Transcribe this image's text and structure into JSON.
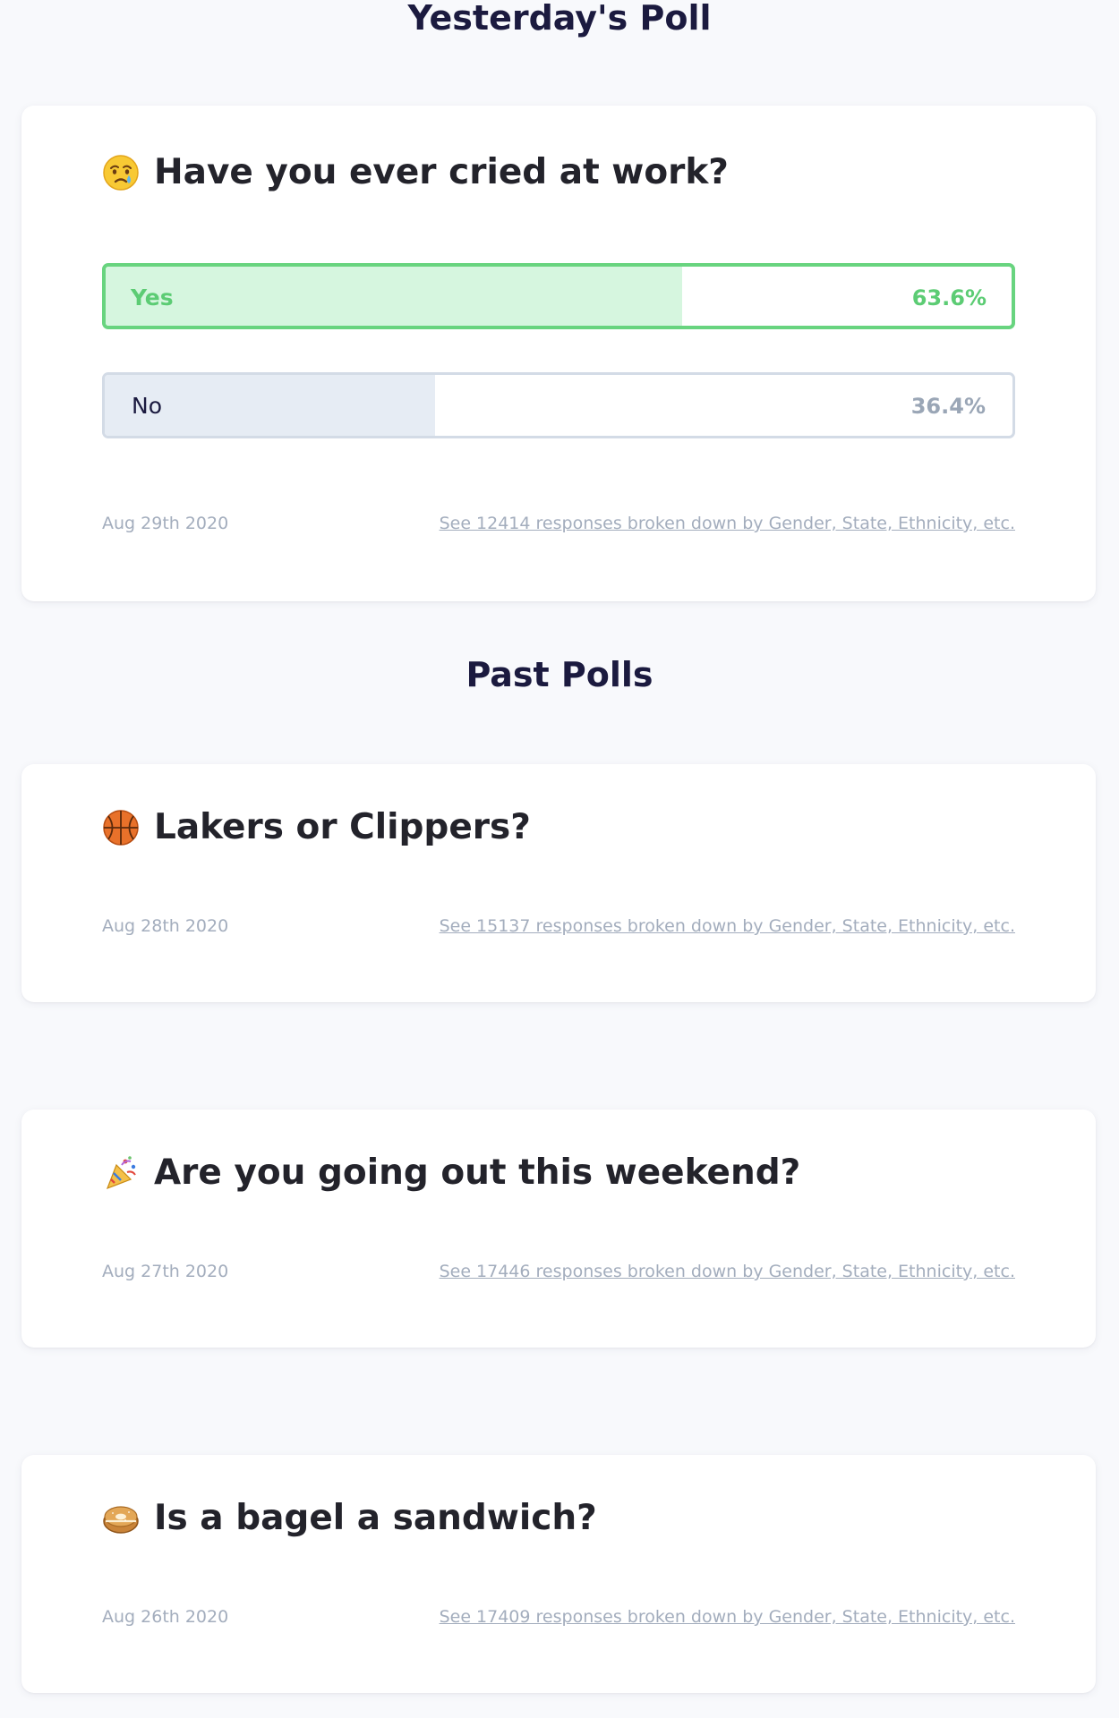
{
  "yesterday": {
    "heading": "Yesterday's Poll",
    "question": "Have you ever cried at work?",
    "emoji": "crying-face-icon",
    "options": [
      {
        "label": "Yes",
        "percent_text": "63.6%",
        "fill_percent": 63.6
      },
      {
        "label": "No",
        "percent_text": "36.4%",
        "fill_percent": 36.4
      }
    ],
    "date": "Aug 29th 2020",
    "link": "See 12414 responses broken down by Gender, State, Ethnicity, etc."
  },
  "past": {
    "heading": "Past Polls",
    "polls": [
      {
        "question": "Lakers or Clippers?",
        "emoji": "basketball-icon",
        "date": "Aug 28th 2020",
        "link": "See 15137 responses broken down by Gender, State, Ethnicity, etc."
      },
      {
        "question": "Are you going out this weekend?",
        "emoji": "party-popper-icon",
        "date": "Aug 27th 2020",
        "link": "See 17446 responses broken down by Gender, State, Ethnicity, etc."
      },
      {
        "question": "Is a bagel a sandwich?",
        "emoji": "bagel-icon",
        "date": "Aug 26th 2020",
        "link": "See 17409 responses broken down by Gender, State, Ethnicity, etc."
      }
    ]
  },
  "colors": {
    "background": "#f8f9fc",
    "heading": "#1b1a3f",
    "yes_border": "#68d47f",
    "yes_fill": "#d6f6df",
    "yes_text": "#5ccc74",
    "no_border": "#d3dbe6",
    "no_fill": "#e6ecf4",
    "meta_text": "#a3adbd"
  }
}
